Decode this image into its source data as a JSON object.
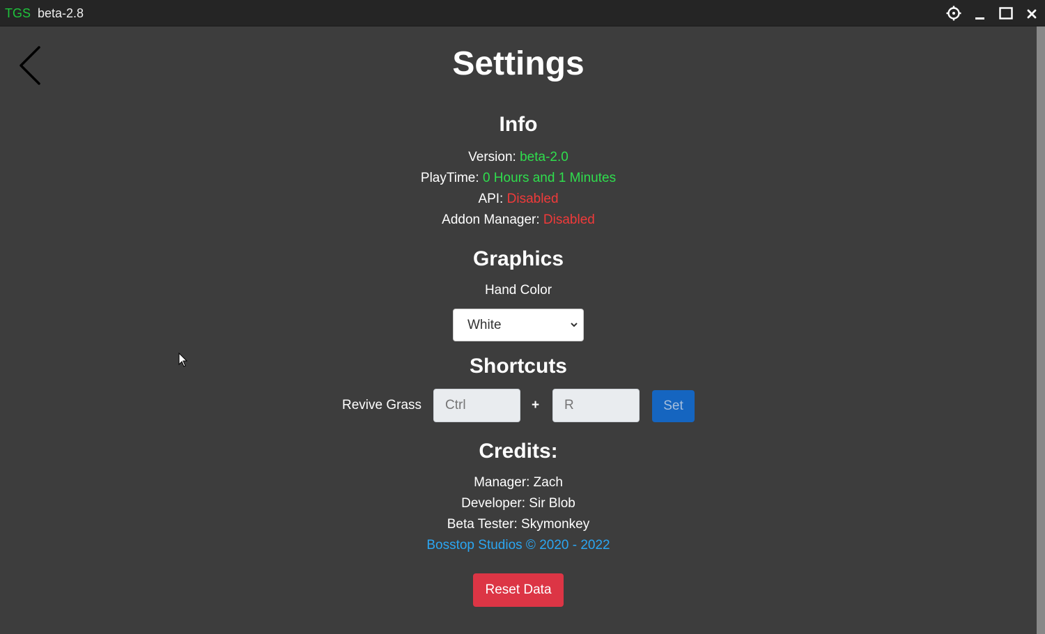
{
  "titlebar": {
    "brand": "TGS",
    "version": "beta-2.8",
    "icons": [
      "gear-icon",
      "minimize-icon",
      "maximize-icon",
      "close-icon"
    ]
  },
  "page": {
    "title": "Settings",
    "back_icon": "chevron-left-icon"
  },
  "info": {
    "heading": "Info",
    "version_label": "Version:",
    "version_value": "beta-2.0",
    "playtime_label": "PlayTime:",
    "playtime_value": "0 Hours and 1 Minutes",
    "api_label": "API:",
    "api_value": "Disabled",
    "addon_label": "Addon Manager:",
    "addon_value": "Disabled"
  },
  "graphics": {
    "heading": "Graphics",
    "hand_color_label": "Hand Color",
    "hand_color_value": "White"
  },
  "shortcuts": {
    "heading": "Shortcuts",
    "revive_label": "Revive Grass",
    "key1_placeholder": "Ctrl",
    "plus": "+",
    "key2_placeholder": "R",
    "set_label": "Set"
  },
  "credits": {
    "heading": "Credits:",
    "manager": "Manager: Zach",
    "developer": "Developer: Sir Blob",
    "tester": "Beta Tester: Skymonkey",
    "copyright": "Bosstop Studios © 2020 - 2022"
  },
  "actions": {
    "reset_label": "Reset Data"
  },
  "colors": {
    "brand": "#1fc43c",
    "enabled": "#2fde4d",
    "disabled": "#f03a3a",
    "link": "#2ba6f2",
    "primary": "#1565c0",
    "danger": "#dc3545"
  }
}
